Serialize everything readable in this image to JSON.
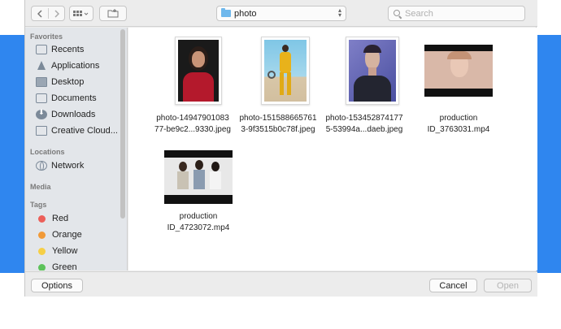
{
  "toolbar": {
    "back_icon": "chevron-left-icon",
    "forward_icon": "chevron-right-icon",
    "view_icon": "icon-grid-view-icon",
    "new_folder_icon": "new-folder-icon",
    "path": "photo",
    "search_placeholder": "Search"
  },
  "sidebar": {
    "favorites_header": "Favorites",
    "favorites": [
      {
        "label": "Recents",
        "icon": "recents-icon"
      },
      {
        "label": "Applications",
        "icon": "applications-icon"
      },
      {
        "label": "Desktop",
        "icon": "desktop-icon"
      },
      {
        "label": "Documents",
        "icon": "documents-icon"
      },
      {
        "label": "Downloads",
        "icon": "downloads-icon"
      },
      {
        "label": "Creative Cloud...",
        "icon": "folder-icon"
      }
    ],
    "locations_header": "Locations",
    "locations": [
      {
        "label": "Network",
        "icon": "network-icon"
      }
    ],
    "media_header": "Media",
    "tags_header": "Tags",
    "tags": [
      {
        "label": "Red",
        "color": "#ec5f59"
      },
      {
        "label": "Orange",
        "color": "#f19a38"
      },
      {
        "label": "Yellow",
        "color": "#f6cf46"
      },
      {
        "label": "Green",
        "color": "#5cc25a"
      }
    ]
  },
  "files": [
    {
      "line1": "photo-14947901083",
      "line2": "77-be9c2...9330.jpeg"
    },
    {
      "line1": "photo-151588665761",
      "line2": "3-9f3515b0c78f.jpeg"
    },
    {
      "line1": "photo-153452874177",
      "line2": "5-53994a...daeb.jpeg"
    },
    {
      "line1": "production",
      "line2": "ID_3763031.mp4"
    },
    {
      "line1": "production",
      "line2": "ID_4723072.mp4"
    }
  ],
  "buttons": {
    "options": "Options",
    "cancel": "Cancel",
    "open": "Open"
  },
  "colors": {
    "accent": "#2f86ef",
    "folder": "#6fb8ec"
  }
}
